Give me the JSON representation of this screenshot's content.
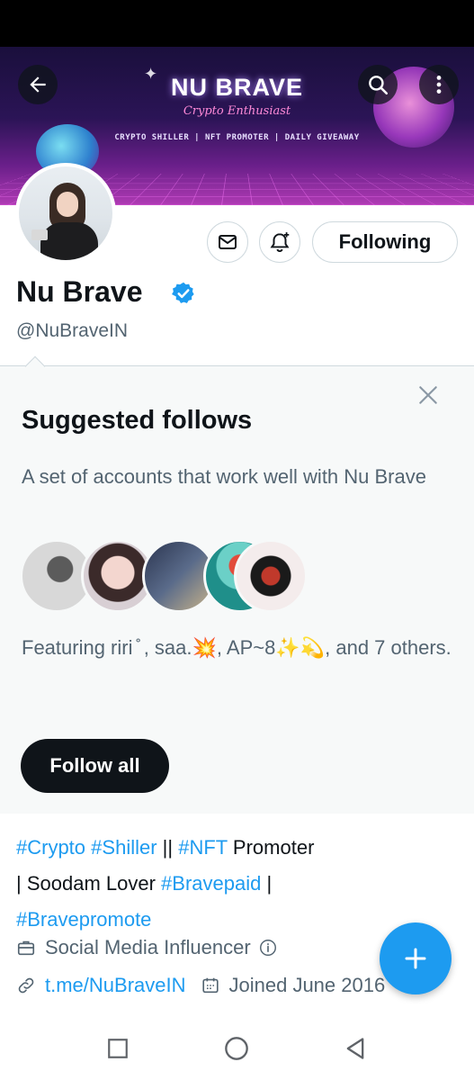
{
  "banner": {
    "title": "NU BRAVE",
    "subtitle": "Crypto Enthusiast",
    "tagline": "CRYPTO SHILLER | NFT PROMOTER | DAILY GIVEAWAY"
  },
  "header": {
    "back_icon": "arrow-left-icon",
    "search_icon": "search-icon",
    "more_icon": "more-vertical-icon"
  },
  "profile": {
    "display_name": "Nu Brave",
    "handle": "@NuBraveIN",
    "verified": true,
    "following_label": "Following"
  },
  "suggested": {
    "title": "Suggested follows",
    "description": "A set of accounts that work well with Nu Brave",
    "featuring": "Featuring riri ̊ , saa.💥, AP~8✨💫, and 7 others.",
    "follow_all_label": "Follow all"
  },
  "bio": {
    "tag_crypto": "#Crypto",
    "tag_shiller": "#Shiller",
    "sep1": " || ",
    "tag_nft": "#NFT",
    "promoter": " Promoter",
    "lover": "| Soodam Lover ",
    "tag_bravepaid": "#Bravepaid",
    "sep2": " |",
    "tag_bravepromote": "#Bravepromote"
  },
  "meta": {
    "occupation": "Social Media Influencer",
    "link": "t.me/NuBraveIN",
    "joined": "Joined June 2016"
  },
  "colors": {
    "accent": "#1d9bf0",
    "text_primary": "#0f1419",
    "text_secondary": "#536471"
  }
}
